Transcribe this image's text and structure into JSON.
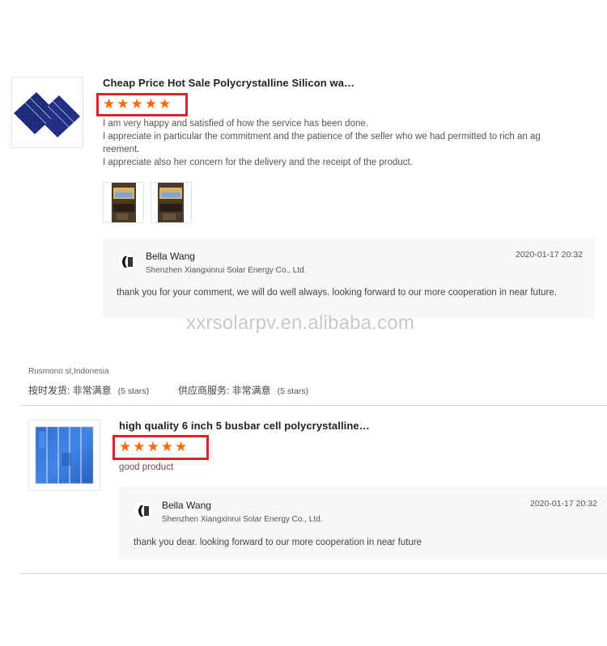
{
  "review1": {
    "product_title": "Cheap Price Hot Sale Polycrystalline Silicon wa…",
    "stars": [
      "★",
      "★",
      "★",
      "★",
      "★"
    ],
    "text_lines": [
      "I am very happy and satisfied of how the service has been done.",
      "I appreciate in particular the commitment and the patience of the seller who we had permitted to rich an ag",
      "reement.",
      "I appreciate also her  concern for the delivery and the receipt of the product."
    ],
    "reply": {
      "name": "Bella Wang",
      "company": "Shenzhen Xiangxinrui Solar Energy Co., Ltd.",
      "date": "2020-01-17 20:32",
      "text": "thank you for your comment,  we will do well always. looking forward to  our more cooperation in near future."
    }
  },
  "watermark": "xxrsolarpv.en.alibaba.com",
  "reviewer2": {
    "location": "Rusmono st,Indonesia",
    "ratings": [
      {
        "label": "按时发货: 非常满意",
        "count": "(5 stars)"
      },
      {
        "label": "供应商服务: 非常满意",
        "count": "(5 stars)"
      }
    ]
  },
  "review2": {
    "product_title": "high quality 6 inch 5 busbar cell polycrystalline…",
    "stars": [
      "★",
      "★",
      "★",
      "★",
      "★"
    ],
    "text": "good product",
    "reply": {
      "name": "Bella Wang",
      "company": "Shenzhen Xiangxinrui Solar Energy Co., Ltd.",
      "date": "2020-01-17 20:32",
      "text": "thank you dear. looking forward to  our more cooperation in near future"
    }
  },
  "colors": {
    "star": "#ff6a00",
    "highlight_box": "#d9232d",
    "reply_bg": "#f6f7f9"
  }
}
